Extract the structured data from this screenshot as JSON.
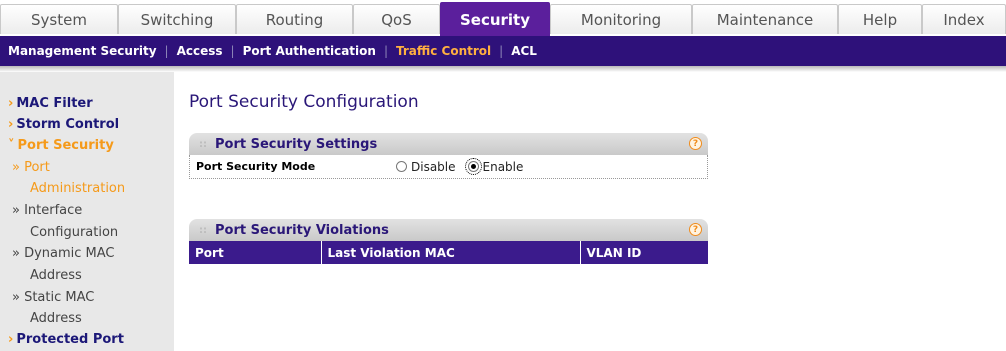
{
  "tabs": [
    {
      "label": "System",
      "active": false
    },
    {
      "label": "Switching",
      "active": false
    },
    {
      "label": "Routing",
      "active": false
    },
    {
      "label": "QoS",
      "active": false
    },
    {
      "label": "Security",
      "active": true
    },
    {
      "label": "Monitoring",
      "active": false
    },
    {
      "label": "Maintenance",
      "active": false
    },
    {
      "label": "Help",
      "active": false
    },
    {
      "label": "Index",
      "active": false
    }
  ],
  "subnav": {
    "items": [
      {
        "label": "Management Security",
        "active": false
      },
      {
        "label": "Access",
        "active": false
      },
      {
        "label": "Port Authentication",
        "active": false
      },
      {
        "label": "Traffic Control",
        "active": true
      },
      {
        "label": "ACL",
        "active": false
      }
    ],
    "separator": "|"
  },
  "leftnav": {
    "mac_filter": "MAC Filter",
    "storm_control": "Storm Control",
    "port_security": "Port Security",
    "port_admin_1": "» Port",
    "port_admin_2": "Administration",
    "interface_1": "» Interface",
    "interface_2": "Configuration",
    "dynamic_1": "» Dynamic MAC",
    "dynamic_2": "Address",
    "static_1": "» Static MAC",
    "static_2": "Address",
    "protected_port": "Protected Port"
  },
  "page_title": "Port Security Configuration",
  "settings_panel": {
    "title": "Port Security Settings",
    "mode_label": "Port Security Mode",
    "options": [
      "Disable",
      "Enable"
    ],
    "selected": "Enable"
  },
  "violations_panel": {
    "title": "Port Security Violations",
    "columns": [
      "Port",
      "Last Violation MAC",
      "VLAN ID"
    ]
  },
  "colors": {
    "accent": "#5b1f9c",
    "subnav_bg": "#2e117a",
    "active_orange": "#f59a1a"
  }
}
